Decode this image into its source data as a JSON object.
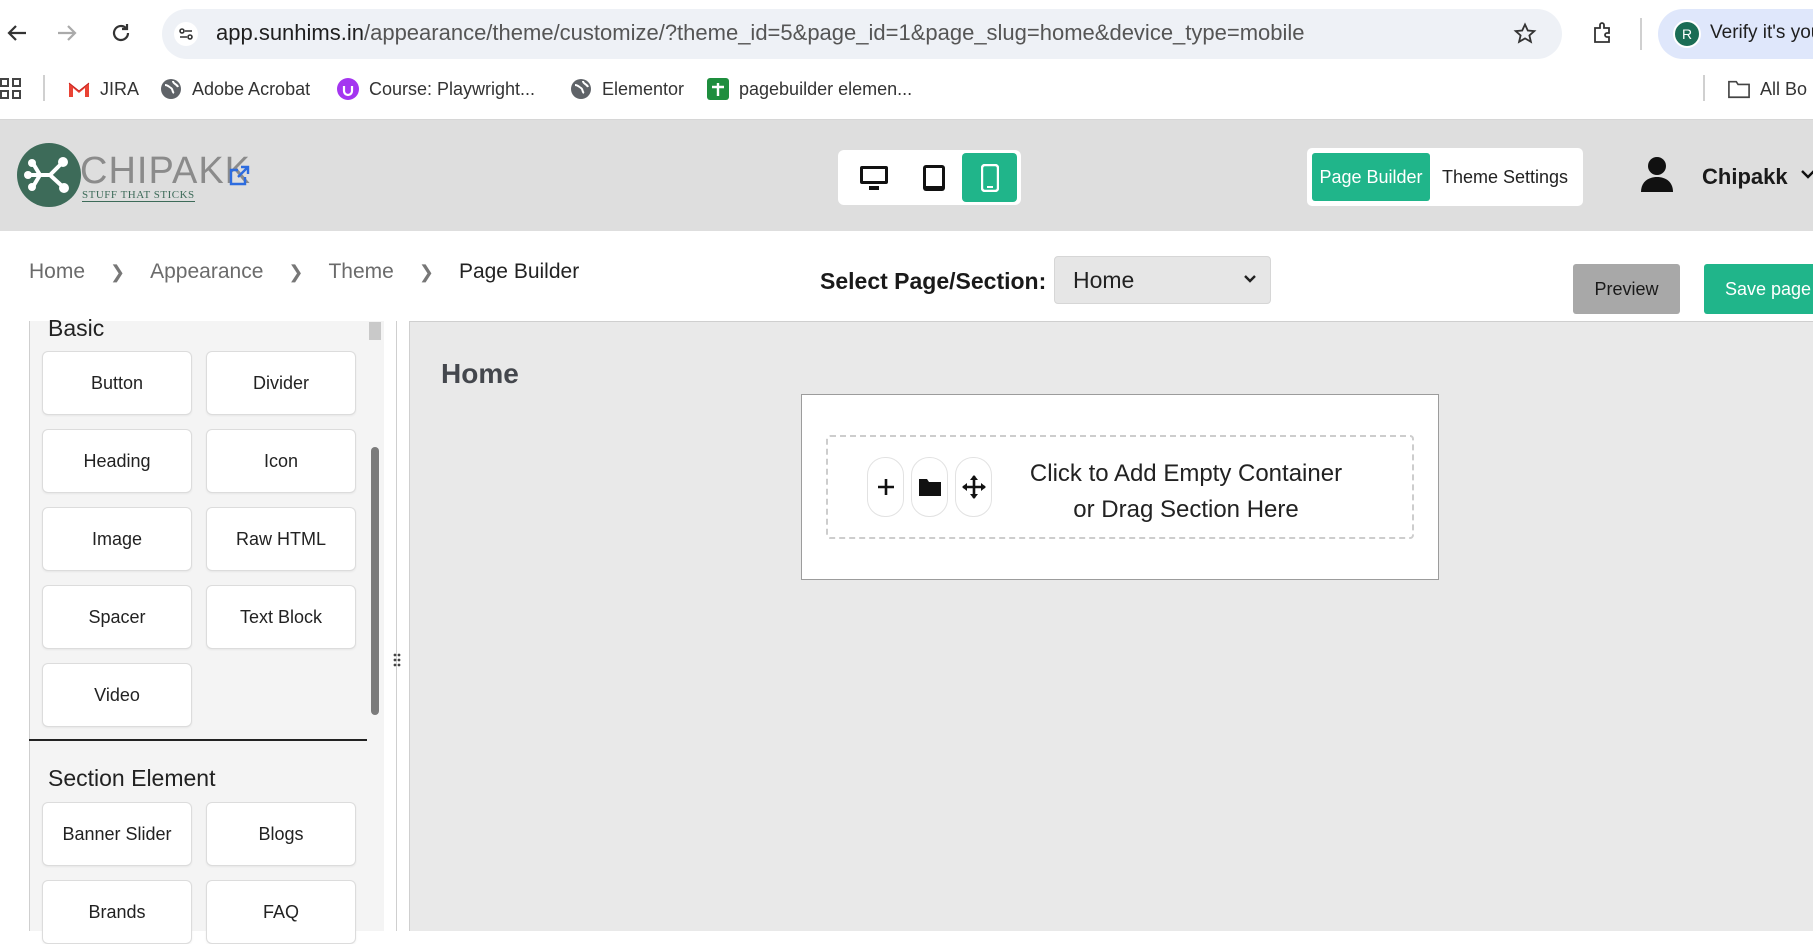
{
  "browser": {
    "url_host": "app.sunhims.in",
    "url_path": "/appearance/theme/customize/?theme_id=5&page_id=1&page_slug=home&device_type=mobile",
    "profile_chip": "Verify it's you",
    "profile_initial": "R",
    "bookmarks": [
      {
        "label": "JIRA",
        "icon": "gmail-icon"
      },
      {
        "label": "Adobe Acrobat",
        "icon": "globe-icon"
      },
      {
        "label": "Course: Playwright...",
        "icon": "udemy-icon"
      },
      {
        "label": "Elementor",
        "icon": "globe-icon"
      },
      {
        "label": "pagebuilder elemen...",
        "icon": "sheets-icon"
      }
    ],
    "all_bookmarks": "All Bo"
  },
  "header": {
    "brand": "CHIPAKK",
    "tagline": "STUFF THAT STICKS",
    "devices": [
      "desktop",
      "tablet",
      "mobile"
    ],
    "active_device": "mobile",
    "mode_page_builder": "Page Builder",
    "mode_theme_settings": "Theme Settings",
    "user_name": "Chipakk",
    "accent_color": "#20b58a"
  },
  "breadcrumb": {
    "items": [
      "Home",
      "Appearance",
      "Theme"
    ],
    "current": "Page Builder"
  },
  "toolbar": {
    "select_label": "Select Page/Section:",
    "select_value": "Home",
    "preview_label": "Preview",
    "save_label": "Save page"
  },
  "sidebar": {
    "basic_title": "Basic",
    "basic_items": [
      "Button",
      "Divider",
      "Heading",
      "Icon",
      "Image",
      "Raw HTML",
      "Spacer",
      "Text Block",
      "Video"
    ],
    "section_title": "Section Element",
    "section_items": [
      "Banner Slider",
      "Blogs",
      "Brands",
      "FAQ"
    ]
  },
  "canvas": {
    "page_title": "Home",
    "dropzone_line1": "Click to Add Empty Container",
    "dropzone_line2": "or Drag Section Here"
  }
}
